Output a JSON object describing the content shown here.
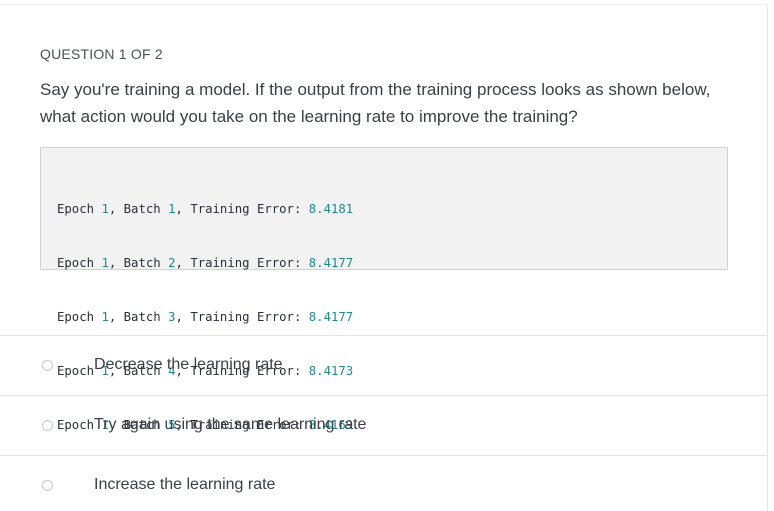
{
  "quiz": {
    "question_label": "QUESTION 1 OF 2",
    "question_text": "Say you're training a model. If the output from the training process looks as shown below, what action would you take on the learning rate to improve the training?"
  },
  "code": {
    "lines": [
      {
        "epoch_word": "Epoch",
        "epoch": "1",
        "batch_word": "Batch",
        "batch": "1",
        "error_word": "Training Error:",
        "error": "8.4181"
      },
      {
        "epoch_word": "Epoch",
        "epoch": "1",
        "batch_word": "Batch",
        "batch": "2",
        "error_word": "Training Error:",
        "error": "8.4177"
      },
      {
        "epoch_word": "Epoch",
        "epoch": "1",
        "batch_word": "Batch",
        "batch": "3",
        "error_word": "Training Error:",
        "error": "8.4177"
      },
      {
        "epoch_word": "Epoch",
        "epoch": "1",
        "batch_word": "Batch",
        "batch": "4",
        "error_word": "Training Error:",
        "error": "8.4173"
      },
      {
        "epoch_word": "Epoch",
        "epoch": "1",
        "batch_word": "Batch",
        "batch": "5",
        "error_word": "Training Error:",
        "error": "8.4169"
      }
    ]
  },
  "options": [
    {
      "label": "Decrease the learning rate",
      "selected": false
    },
    {
      "label": "Try again using the same learning rate",
      "selected": false
    },
    {
      "label": "Increase the learning rate",
      "selected": false
    }
  ],
  "colors": {
    "number_accent": "#1f8a8a",
    "code_background": "#f2f2f2"
  }
}
